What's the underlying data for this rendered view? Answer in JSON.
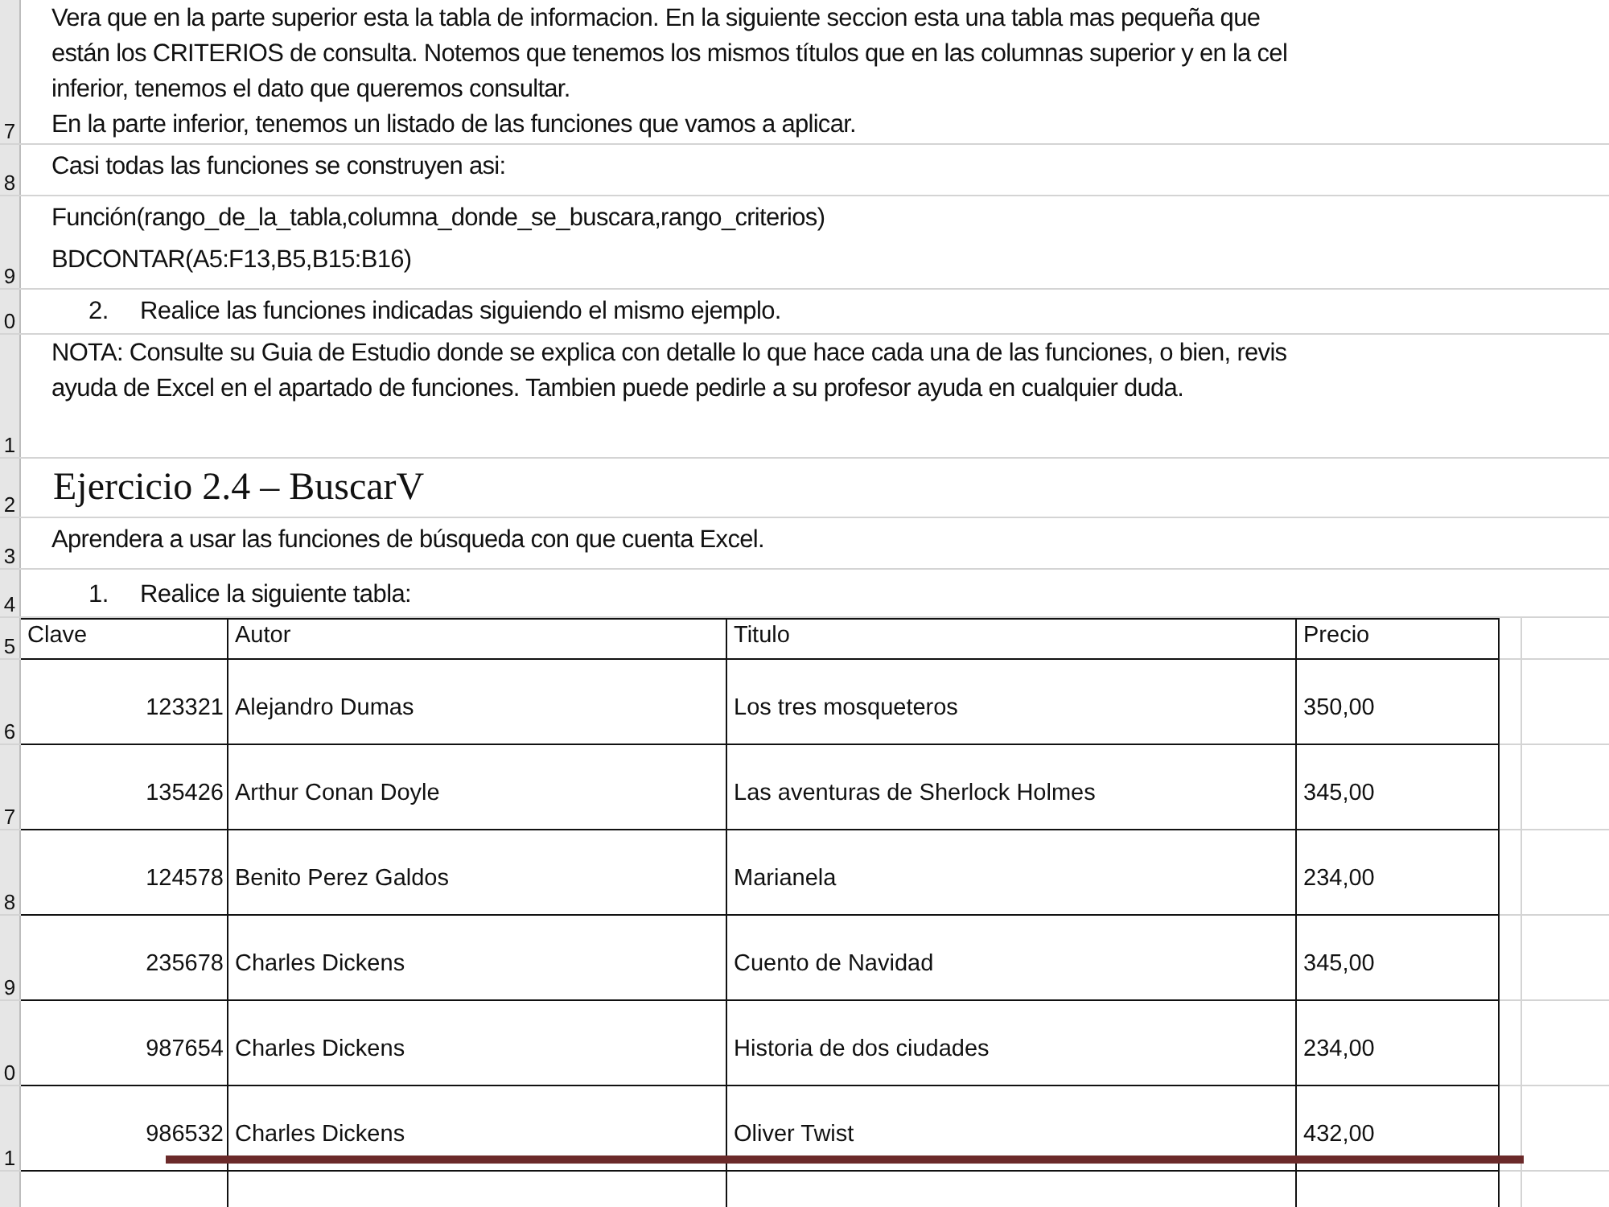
{
  "rows": [
    {
      "header": "7",
      "kind": "text",
      "lines": [
        "Vera que en la parte superior esta la tabla de informacion. En la siguiente seccion esta una tabla mas pequeña que",
        "están los CRITERIOS de consulta. Notemos que tenemos los mismos títulos que en las columnas superior y en la cel",
        "inferior, tenemos el dato que queremos consultar.",
        "En la parte inferior, tenemos un listado de las funciones que vamos a aplicar."
      ]
    },
    {
      "header": "8",
      "kind": "text",
      "lines": [
        "Casi todas las funciones se construyen asi:"
      ]
    },
    {
      "header": "9",
      "kind": "text",
      "lines": [
        "Función(rango_de_la_tabla,columna_donde_se_buscara,rango_criterios)",
        "BDCONTAR(A5:F13,B5,B15:B16)"
      ]
    },
    {
      "header": "0",
      "kind": "list_item",
      "number": "2.",
      "text": "Realice las funciones indicadas siguiendo el mismo ejemplo."
    },
    {
      "header": "1",
      "kind": "text",
      "lines": [
        "NOTA: Consulte su Guia de Estudio donde se explica con detalle lo que hace cada una de las funciones, o bien, revis",
        "ayuda de Excel en el apartado de funciones. Tambien puede pedirle a su profesor ayuda en cualquier duda."
      ]
    },
    {
      "header": "2",
      "kind": "heading",
      "text": "Ejercicio 2.4 – BuscarV"
    },
    {
      "header": "3",
      "kind": "text",
      "lines": [
        "Aprendera a usar las funciones de búsqueda con que cuenta Excel."
      ]
    },
    {
      "header": "4",
      "kind": "list_item",
      "number": "1.",
      "text": "Realice la siguiente tabla:"
    }
  ],
  "table": {
    "header": "5",
    "columns": [
      "Clave",
      "Autor",
      "Titulo",
      "Precio"
    ],
    "rows": [
      {
        "header": "6",
        "cells": [
          "123321",
          "Alejandro Dumas",
          "Los tres mosqueteros",
          "350,00"
        ]
      },
      {
        "header": "7",
        "cells": [
          "135426",
          "Arthur Conan Doyle",
          "Las aventuras de Sherlock Holmes",
          "345,00"
        ]
      },
      {
        "header": "8",
        "cells": [
          "124578",
          "Benito Perez Galdos",
          "Marianela",
          "234,00"
        ]
      },
      {
        "header": "9",
        "cells": [
          "235678",
          "Charles Dickens",
          "Cuento de Navidad",
          "345,00"
        ]
      },
      {
        "header": "0",
        "cells": [
          "987654",
          "Charles Dickens",
          "Historia de dos ciudades",
          "234,00"
        ]
      },
      {
        "header": "1",
        "cells": [
          "986532",
          "Charles Dickens",
          "Oliver Twist",
          "432,00"
        ]
      }
    ]
  }
}
